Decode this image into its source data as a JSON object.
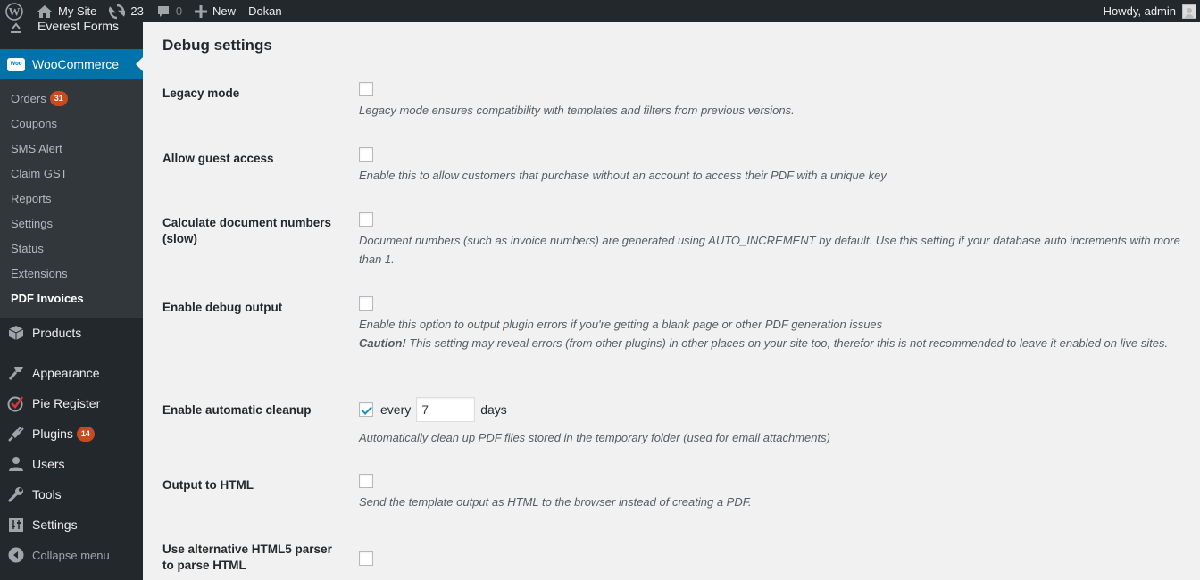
{
  "adminbar": {
    "site_name": "My Site",
    "updates_count": "23",
    "comments_count": "0",
    "new_label": "New",
    "dokan_label": "Dokan",
    "howdy": "Howdy, admin",
    "icons": [
      "wordpress-logo",
      "home-icon",
      "refresh-icon",
      "comment-icon",
      "plus-icon"
    ]
  },
  "sidebar": {
    "partial_item": "Everest Forms",
    "current": {
      "label": "WooCommerce",
      "icon": "woo-icon"
    },
    "submenu": [
      {
        "label": "Orders",
        "badge": "31"
      },
      {
        "label": "Coupons"
      },
      {
        "label": "SMS Alert"
      },
      {
        "label": "Claim GST"
      },
      {
        "label": "Reports"
      },
      {
        "label": "Settings"
      },
      {
        "label": "Status"
      },
      {
        "label": "Extensions"
      },
      {
        "label": "PDF Invoices",
        "active": true
      }
    ],
    "items": [
      {
        "label": "Products",
        "icon": "box-icon"
      },
      {
        "label": "Appearance",
        "icon": "paintbrush-icon"
      },
      {
        "label": "Pie Register",
        "icon": "pie-register-icon"
      },
      {
        "label": "Plugins",
        "icon": "plug-icon",
        "badge": "14"
      },
      {
        "label": "Users",
        "icon": "user-icon"
      },
      {
        "label": "Tools",
        "icon": "wrench-icon"
      },
      {
        "label": "Settings",
        "icon": "sliders-icon"
      }
    ],
    "collapse_label": "Collapse menu",
    "accent_color": "#0073aa",
    "badge_color": "#ca4a1f"
  },
  "main": {
    "title": "Debug settings",
    "settings": [
      {
        "label": "Legacy mode",
        "checked": false,
        "description": "Legacy mode ensures compatibility with templates and filters from previous versions."
      },
      {
        "label": "Allow guest access",
        "checked": false,
        "description": "Enable this to allow customers that purchase without an account to access their PDF with a unique key"
      },
      {
        "label": "Calculate document numbers (slow)",
        "checked": false,
        "description": "Document numbers (such as invoice numbers) are generated using AUTO_INCREMENT by default. Use this setting if your database auto increments with more than 1."
      },
      {
        "label": "Enable debug output",
        "checked": false,
        "description": "Enable this option to output plugin errors if you're getting a blank page or other PDF generation issues",
        "caution_label": "Caution!",
        "caution_text": " This setting may reveal errors (from other plugins) in other places on your site too, therefor this is not recommended to leave it enabled on live sites."
      },
      {
        "label": "Enable automatic cleanup",
        "checked": true,
        "prefix": "every",
        "value": "7",
        "suffix": "days",
        "description": "Automatically clean up PDF files stored in the temporary folder (used for email attachments)"
      },
      {
        "label": "Output to HTML",
        "checked": false,
        "description": "Send the template output as HTML to the browser instead of creating a PDF."
      },
      {
        "label": "Use alternative HTML5 parser to parse HTML",
        "checked": false
      }
    ]
  }
}
